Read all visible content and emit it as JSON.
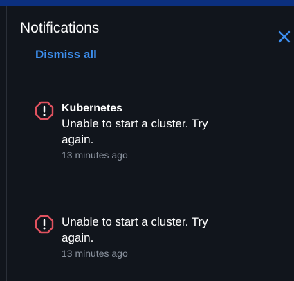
{
  "header": {
    "title": "Notifications",
    "close_icon": "close-icon",
    "dismiss_all_label": "Dismiss all"
  },
  "colors": {
    "top_bar": "#0b2f7e",
    "background": "#11151c",
    "accent": "#3d8fef",
    "error": "#e0525f",
    "muted_text": "#8a929e"
  },
  "notifications": [
    {
      "icon": "alert-octagon-icon",
      "title": "Kubernetes",
      "message": "Unable to start a cluster. Try again.",
      "time": "13 minutes ago"
    },
    {
      "icon": "alert-octagon-icon",
      "title": "",
      "message": "Unable to start a cluster. Try again.",
      "time": "13 minutes ago"
    }
  ]
}
